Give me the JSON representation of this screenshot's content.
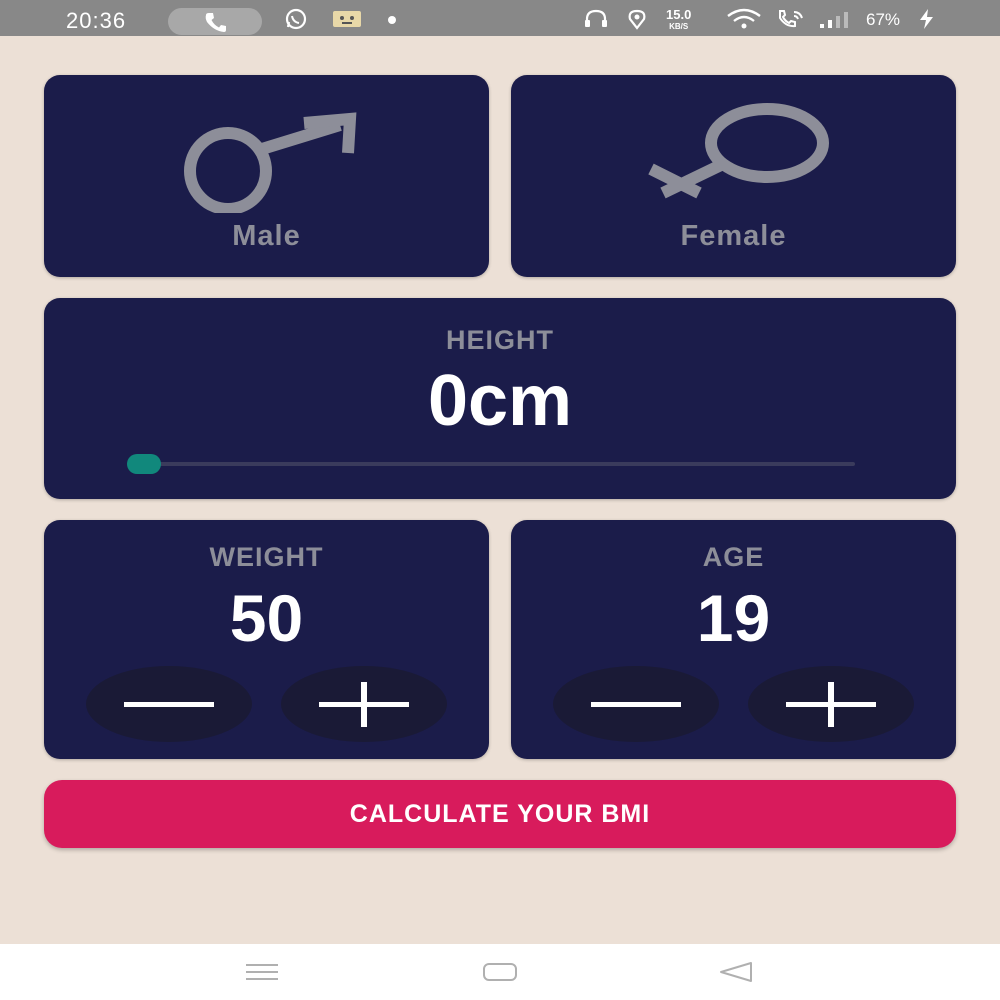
{
  "status_bar": {
    "time": "20:36",
    "speed_value": "15.0",
    "speed_unit": "KB/S",
    "battery": "67%",
    "icons": [
      "phone-call-icon",
      "whatsapp-icon",
      "notification-icon",
      "dot-icon",
      "headset-icon",
      "location-icon",
      "wifi-icon",
      "wifi-calling-icon",
      "signal-icon",
      "charging-icon"
    ]
  },
  "gender": {
    "male_label": "Male",
    "female_label": "Female",
    "male_icon": "male-symbol-icon",
    "female_icon": "female-symbol-icon"
  },
  "height": {
    "title": "HEIGHT",
    "value": "0cm",
    "slider_fraction": 0
  },
  "weight": {
    "title": "WEIGHT",
    "value": "50"
  },
  "age": {
    "title": "AGE",
    "value": "19"
  },
  "actions": {
    "calculate_label": "CALCULATE YOUR BMI"
  },
  "nav": {
    "icons": [
      "menu-icon",
      "home-icon",
      "back-icon"
    ]
  },
  "colors": {
    "background": "#ece0d6",
    "card": "#1b1c4a",
    "label_gray": "#8d8e99",
    "accent_pink": "#d81b5c",
    "slider_teal": "#11887c",
    "round_button": "#1a1a36"
  }
}
